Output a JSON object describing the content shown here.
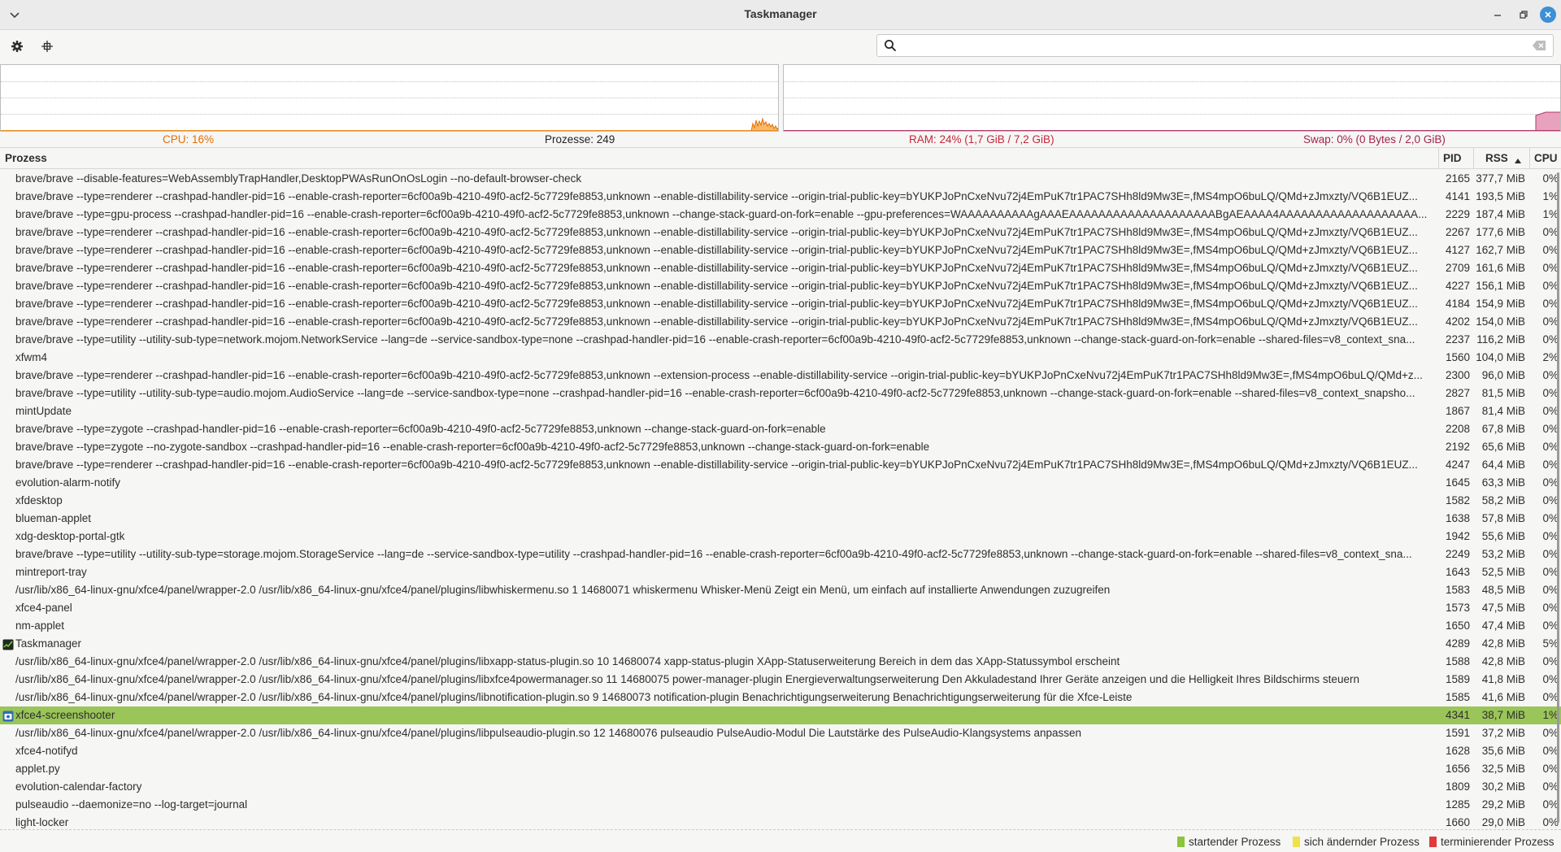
{
  "window": {
    "title": "Taskmanager"
  },
  "search": {
    "value": "",
    "placeholder": ""
  },
  "stats": {
    "cpu": "CPU: 16%",
    "processes": "Prozesse: 249",
    "ram": "RAM: 24% (1,7 GiB / 7,2 GiB)",
    "swap": "Swap: 0% (0 Bytes / 2,0 GiB)"
  },
  "graphs": {
    "cpu_percent": 16,
    "ram_percent": 24,
    "swap_percent": 0
  },
  "colors": {
    "cpu": "#e86e00",
    "ram": "#c8263a",
    "swap": "#a3244e",
    "selection": "#9ac558",
    "starting": "#8cc43c",
    "changing": "#f0e04a",
    "terminating": "#e0393e"
  },
  "table": {
    "headers": {
      "process": "Prozess",
      "pid": "PID",
      "rss": "RSS",
      "cpu": "CPU"
    },
    "sort": {
      "column": "RSS",
      "direction": "ascending-arrow"
    },
    "rows": [
      {
        "name": "brave/brave --disable-features=WebAssemblyTrapHandler,DesktopPWAsRunOnOsLogin --no-default-browser-check",
        "pid": "2165",
        "rss": "377,7 MiB",
        "cpu": "0%"
      },
      {
        "name": "brave/brave --type=renderer --crashpad-handler-pid=16 --enable-crash-reporter=6cf00a9b-4210-49f0-acf2-5c7729fe8853,unknown --enable-distillability-service --origin-trial-public-key=bYUKPJoPnCxeNvu72j4EmPuK7tr1PAC7SHh8ld9Mw3E=,fMS4mpO6buLQ/QMd+zJmxzty/VQ6B1EUZ...",
        "pid": "4141",
        "rss": "193,5 MiB",
        "cpu": "1%"
      },
      {
        "name": "brave/brave --type=gpu-process --crashpad-handler-pid=16 --enable-crash-reporter=6cf00a9b-4210-49f0-acf2-5c7729fe8853,unknown --change-stack-guard-on-fork=enable --gpu-preferences=WAAAAAAAAAAgAAAEAAAAAAAAAAAAAAAAAAAABgAEAAAA4AAAAAAAAAAAAAAAAAAA...",
        "pid": "2229",
        "rss": "187,4 MiB",
        "cpu": "1%"
      },
      {
        "name": "brave/brave --type=renderer --crashpad-handler-pid=16 --enable-crash-reporter=6cf00a9b-4210-49f0-acf2-5c7729fe8853,unknown --enable-distillability-service --origin-trial-public-key=bYUKPJoPnCxeNvu72j4EmPuK7tr1PAC7SHh8ld9Mw3E=,fMS4mpO6buLQ/QMd+zJmxzty/VQ6B1EUZ...",
        "pid": "2267",
        "rss": "177,6 MiB",
        "cpu": "0%"
      },
      {
        "name": "brave/brave --type=renderer --crashpad-handler-pid=16 --enable-crash-reporter=6cf00a9b-4210-49f0-acf2-5c7729fe8853,unknown --enable-distillability-service --origin-trial-public-key=bYUKPJoPnCxeNvu72j4EmPuK7tr1PAC7SHh8ld9Mw3E=,fMS4mpO6buLQ/QMd+zJmxzty/VQ6B1EUZ...",
        "pid": "4127",
        "rss": "162,7 MiB",
        "cpu": "0%"
      },
      {
        "name": "brave/brave --type=renderer --crashpad-handler-pid=16 --enable-crash-reporter=6cf00a9b-4210-49f0-acf2-5c7729fe8853,unknown --enable-distillability-service --origin-trial-public-key=bYUKPJoPnCxeNvu72j4EmPuK7tr1PAC7SHh8ld9Mw3E=,fMS4mpO6buLQ/QMd+zJmxzty/VQ6B1EUZ...",
        "pid": "2709",
        "rss": "161,6 MiB",
        "cpu": "0%"
      },
      {
        "name": "brave/brave --type=renderer --crashpad-handler-pid=16 --enable-crash-reporter=6cf00a9b-4210-49f0-acf2-5c7729fe8853,unknown --enable-distillability-service --origin-trial-public-key=bYUKPJoPnCxeNvu72j4EmPuK7tr1PAC7SHh8ld9Mw3E=,fMS4mpO6buLQ/QMd+zJmxzty/VQ6B1EUZ...",
        "pid": "4227",
        "rss": "156,1 MiB",
        "cpu": "0%"
      },
      {
        "name": "brave/brave --type=renderer --crashpad-handler-pid=16 --enable-crash-reporter=6cf00a9b-4210-49f0-acf2-5c7729fe8853,unknown --enable-distillability-service --origin-trial-public-key=bYUKPJoPnCxeNvu72j4EmPuK7tr1PAC7SHh8ld9Mw3E=,fMS4mpO6buLQ/QMd+zJmxzty/VQ6B1EUZ...",
        "pid": "4184",
        "rss": "154,9 MiB",
        "cpu": "0%"
      },
      {
        "name": "brave/brave --type=renderer --crashpad-handler-pid=16 --enable-crash-reporter=6cf00a9b-4210-49f0-acf2-5c7729fe8853,unknown --enable-distillability-service --origin-trial-public-key=bYUKPJoPnCxeNvu72j4EmPuK7tr1PAC7SHh8ld9Mw3E=,fMS4mpO6buLQ/QMd+zJmxzty/VQ6B1EUZ...",
        "pid": "4202",
        "rss": "154,0 MiB",
        "cpu": "0%"
      },
      {
        "name": "brave/brave --type=utility --utility-sub-type=network.mojom.NetworkService --lang=de --service-sandbox-type=none --crashpad-handler-pid=16 --enable-crash-reporter=6cf00a9b-4210-49f0-acf2-5c7729fe8853,unknown --change-stack-guard-on-fork=enable --shared-files=v8_context_sna...",
        "pid": "2237",
        "rss": "116,2 MiB",
        "cpu": "0%"
      },
      {
        "name": "xfwm4",
        "pid": "1560",
        "rss": "104,0 MiB",
        "cpu": "2%"
      },
      {
        "name": "brave/brave --type=renderer --crashpad-handler-pid=16 --enable-crash-reporter=6cf00a9b-4210-49f0-acf2-5c7729fe8853,unknown --extension-process --enable-distillability-service --origin-trial-public-key=bYUKPJoPnCxeNvu72j4EmPuK7tr1PAC7SHh8ld9Mw3E=,fMS4mpO6buLQ/QMd+z...",
        "pid": "2300",
        "rss": "96,0 MiB",
        "cpu": "0%"
      },
      {
        "name": "brave/brave --type=utility --utility-sub-type=audio.mojom.AudioService --lang=de --service-sandbox-type=none --crashpad-handler-pid=16 --enable-crash-reporter=6cf00a9b-4210-49f0-acf2-5c7729fe8853,unknown --change-stack-guard-on-fork=enable --shared-files=v8_context_snapsho...",
        "pid": "2827",
        "rss": "81,5 MiB",
        "cpu": "0%"
      },
      {
        "name": "mintUpdate",
        "pid": "1867",
        "rss": "81,4 MiB",
        "cpu": "0%"
      },
      {
        "name": "brave/brave --type=zygote --crashpad-handler-pid=16 --enable-crash-reporter=6cf00a9b-4210-49f0-acf2-5c7729fe8853,unknown --change-stack-guard-on-fork=enable",
        "pid": "2208",
        "rss": "67,8 MiB",
        "cpu": "0%"
      },
      {
        "name": "brave/brave --type=zygote --no-zygote-sandbox --crashpad-handler-pid=16 --enable-crash-reporter=6cf00a9b-4210-49f0-acf2-5c7729fe8853,unknown --change-stack-guard-on-fork=enable",
        "pid": "2192",
        "rss": "65,6 MiB",
        "cpu": "0%"
      },
      {
        "name": "brave/brave --type=renderer --crashpad-handler-pid=16 --enable-crash-reporter=6cf00a9b-4210-49f0-acf2-5c7729fe8853,unknown --enable-distillability-service --origin-trial-public-key=bYUKPJoPnCxeNvu72j4EmPuK7tr1PAC7SHh8ld9Mw3E=,fMS4mpO6buLQ/QMd+zJmxzty/VQ6B1EUZ...",
        "pid": "4247",
        "rss": "64,4 MiB",
        "cpu": "0%"
      },
      {
        "name": "evolution-alarm-notify",
        "pid": "1645",
        "rss": "63,3 MiB",
        "cpu": "0%"
      },
      {
        "name": "xfdesktop",
        "pid": "1582",
        "rss": "58,2 MiB",
        "cpu": "0%"
      },
      {
        "name": "blueman-applet",
        "pid": "1638",
        "rss": "57,8 MiB",
        "cpu": "0%"
      },
      {
        "name": "xdg-desktop-portal-gtk",
        "pid": "1942",
        "rss": "55,6 MiB",
        "cpu": "0%"
      },
      {
        "name": "brave/brave --type=utility --utility-sub-type=storage.mojom.StorageService --lang=de --service-sandbox-type=utility --crashpad-handler-pid=16 --enable-crash-reporter=6cf00a9b-4210-49f0-acf2-5c7729fe8853,unknown --change-stack-guard-on-fork=enable --shared-files=v8_context_sna...",
        "pid": "2249",
        "rss": "53,2 MiB",
        "cpu": "0%"
      },
      {
        "name": "mintreport-tray",
        "pid": "1643",
        "rss": "52,5 MiB",
        "cpu": "0%"
      },
      {
        "name": "/usr/lib/x86_64-linux-gnu/xfce4/panel/wrapper-2.0 /usr/lib/x86_64-linux-gnu/xfce4/panel/plugins/libwhiskermenu.so 1 14680071 whiskermenu Whisker-Menü Zeigt ein Menü, um einfach auf installierte Anwendungen zuzugreifen",
        "pid": "1583",
        "rss": "48,5 MiB",
        "cpu": "0%"
      },
      {
        "name": "xfce4-panel",
        "pid": "1573",
        "rss": "47,5 MiB",
        "cpu": "0%"
      },
      {
        "name": "nm-applet",
        "pid": "1650",
        "rss": "47,4 MiB",
        "cpu": "0%"
      },
      {
        "name": "Taskmanager",
        "pid": "4289",
        "rss": "42,8 MiB",
        "cpu": "5%",
        "icon": "taskmanager-icon"
      },
      {
        "name": "/usr/lib/x86_64-linux-gnu/xfce4/panel/wrapper-2.0 /usr/lib/x86_64-linux-gnu/xfce4/panel/plugins/libxapp-status-plugin.so 10 14680074 xapp-status-plugin XApp-Statuserweiterung Bereich in dem das XApp-Statussymbol erscheint",
        "pid": "1588",
        "rss": "42,8 MiB",
        "cpu": "0%"
      },
      {
        "name": "/usr/lib/x86_64-linux-gnu/xfce4/panel/wrapper-2.0 /usr/lib/x86_64-linux-gnu/xfce4/panel/plugins/libxfce4powermanager.so 11 14680075 power-manager-plugin Energieverwaltungserweiterung Den Akkuladestand Ihrer Geräte anzeigen und die Helligkeit Ihres Bildschirms steuern",
        "pid": "1589",
        "rss": "41,8 MiB",
        "cpu": "0%"
      },
      {
        "name": "/usr/lib/x86_64-linux-gnu/xfce4/panel/wrapper-2.0 /usr/lib/x86_64-linux-gnu/xfce4/panel/plugins/libnotification-plugin.so 9 14680073 notification-plugin Benachrichtigungserweiterung Benachrichtigungserweiterung für die Xfce-Leiste",
        "pid": "1585",
        "rss": "41,6 MiB",
        "cpu": "0%"
      },
      {
        "name": "xfce4-screenshooter",
        "pid": "4341",
        "rss": "38,7 MiB",
        "cpu": "1%",
        "icon": "camera-icon",
        "selected": true
      },
      {
        "name": "/usr/lib/x86_64-linux-gnu/xfce4/panel/wrapper-2.0 /usr/lib/x86_64-linux-gnu/xfce4/panel/plugins/libpulseaudio-plugin.so 12 14680076 pulseaudio PulseAudio-Modul Die Lautstärke des PulseAudio-Klangsystems anpassen",
        "pid": "1591",
        "rss": "37,2 MiB",
        "cpu": "0%"
      },
      {
        "name": "xfce4-notifyd",
        "pid": "1628",
        "rss": "35,6 MiB",
        "cpu": "0%"
      },
      {
        "name": "applet.py",
        "pid": "1656",
        "rss": "32,5 MiB",
        "cpu": "0%"
      },
      {
        "name": "evolution-calendar-factory",
        "pid": "1809",
        "rss": "30,2 MiB",
        "cpu": "0%"
      },
      {
        "name": "pulseaudio --daemonize=no --log-target=journal",
        "pid": "1285",
        "rss": "29,2 MiB",
        "cpu": "0%"
      },
      {
        "name": "light-locker",
        "pid": "1660",
        "rss": "29,0 MiB",
        "cpu": "0%"
      }
    ]
  },
  "legend": {
    "starting": "startender Prozess",
    "changing": "sich ändernder Prozess",
    "terminating": "terminierender Prozess"
  }
}
